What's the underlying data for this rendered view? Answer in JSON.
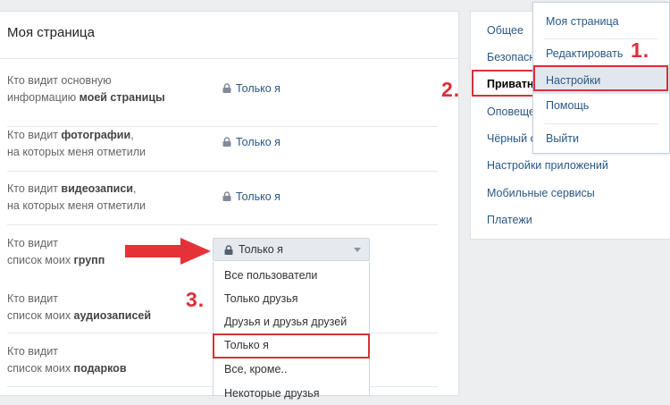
{
  "main": {
    "title": "Моя страница",
    "rows": [
      {
        "l1": "Кто видит основную",
        "l2a": "информацию ",
        "l2b": "моей страницы",
        "value": "Только я"
      },
      {
        "l1a": "Кто видит ",
        "l1b": "фотографии",
        "l1c": ",",
        "l2": "на которых меня отметили",
        "value": "Только я"
      },
      {
        "l1a": "Кто видит ",
        "l1b": "видеозаписи",
        "l1c": ",",
        "l2": "на которых меня отметили",
        "value": "Только я"
      },
      {
        "l1": "Кто видит",
        "l2a": "список моих ",
        "l2b": "групп",
        "value": "Только я"
      },
      {
        "l1": "Кто видит",
        "l2a": "список моих ",
        "l2b": "аудиозаписей"
      },
      {
        "l1": "Кто видит",
        "l2a": "список моих ",
        "l2b": "подарков"
      }
    ]
  },
  "dropdown": {
    "selected": "Только я",
    "options": [
      "Все пользователи",
      "Только друзья",
      "Друзья и друзья друзей",
      "Только я",
      "Все, кроме..",
      "Некоторые друзья"
    ]
  },
  "settings_nav": {
    "items": [
      "Общее",
      "Безопасн",
      "Приватн",
      "Оповещен",
      "Чёрный с",
      "Настройки приложений",
      "Мобильные сервисы",
      "Платежи"
    ],
    "active_index": 2
  },
  "profile_menu": {
    "items": [
      "Моя страница",
      "Редактировать",
      "Настройки",
      "Помощь",
      "Выйти"
    ]
  },
  "steps": {
    "s1": "1.",
    "s2": "2.",
    "s3": "3."
  },
  "colors": {
    "highlight": "#d8303a",
    "link": "#2a5885",
    "background": "#edeef0"
  }
}
